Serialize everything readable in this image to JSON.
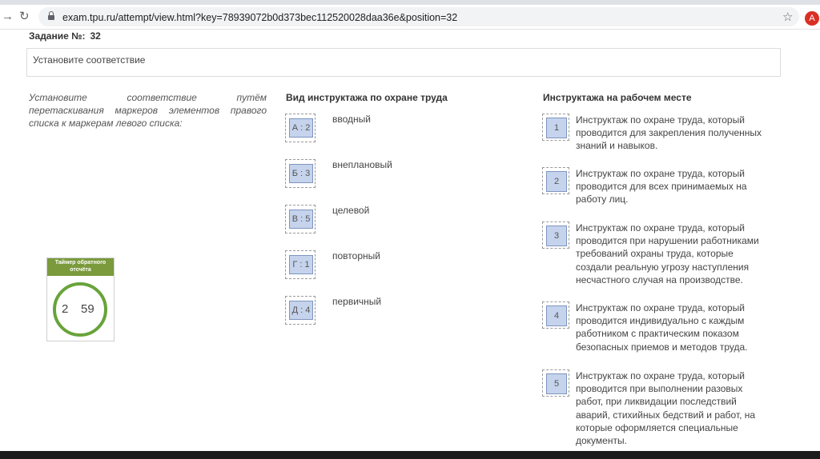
{
  "browser": {
    "url": "exam.tpu.ru/attempt/view.html?key=78939072b0d373bec112520028daa36e&position=32",
    "avatar_letter": "A"
  },
  "task": {
    "label": "Задание №:",
    "number": "32",
    "prompt": "Установите соответствие",
    "instruction": "Установите соответствие путём перетаскивания маркеров элементов правого списка к маркерам левого списка:"
  },
  "left_column": {
    "header": "Вид инструктажа по охране труда",
    "items": [
      {
        "marker": "А : 2",
        "text": "вводный"
      },
      {
        "marker": "Б : 3",
        "text": "внеплановый"
      },
      {
        "marker": "В : 5",
        "text": "целевой"
      },
      {
        "marker": "Г : 1",
        "text": "повторный"
      },
      {
        "marker": "Д : 4",
        "text": "первичный"
      }
    ]
  },
  "right_column": {
    "header": "Инструктажа на рабочем месте",
    "items": [
      {
        "marker": "1",
        "text": "Инструктаж по охране труда, который проводится для закрепления полученных знаний и навыков."
      },
      {
        "marker": "2",
        "text": "Инструктаж по охране труда, который проводится для всех принимаемых на работу лиц."
      },
      {
        "marker": "3",
        "text": "Инструктаж по охране труда, который проводится при нарушении работниками требований охраны труда, которые создали реальную угрозу наступления несчастного случая на производстве."
      },
      {
        "marker": "4",
        "text": "Инструктаж по охране труда, который проводится индивидуально с каждым работником с практическим показом безопасных приемов и методов труда."
      },
      {
        "marker": "5",
        "text": "Инструктаж по охране труда, который проводится при выполнении разовых работ, при ликвидации последствий аварий, стихийных бедствий и работ, на которые оформляется специальные документы."
      }
    ]
  },
  "timer": {
    "title": "Таймер обратного отсчёта",
    "minutes": "2",
    "seconds": "59",
    "ring_color": "#68a33a",
    "header_color": "#7a9a3c"
  }
}
